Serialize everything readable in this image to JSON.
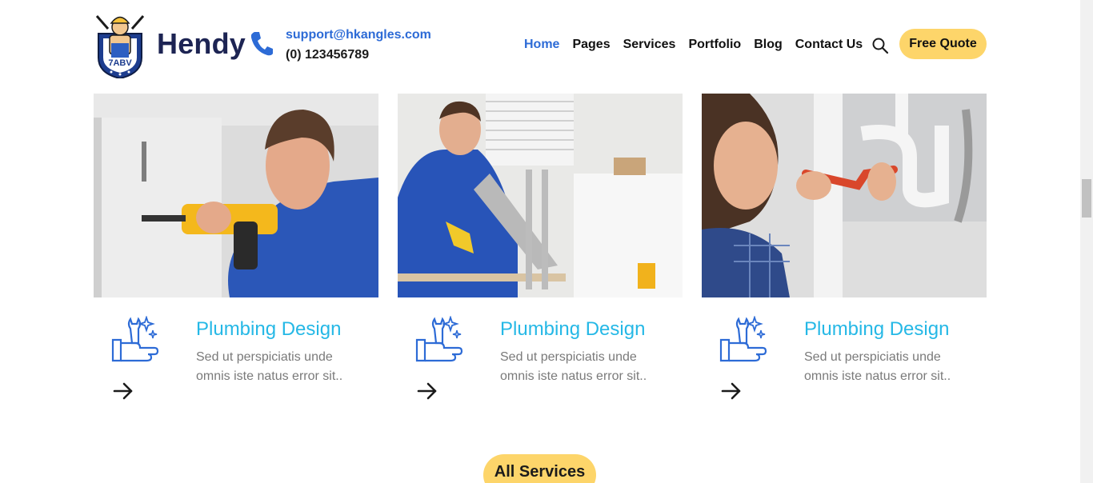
{
  "brand": {
    "name": "Hendy",
    "logo_icon": "plumber-mascot-logo"
  },
  "contact": {
    "email": "support@hkangles.com",
    "phone": "(0) 123456789",
    "icon": "phone-icon"
  },
  "nav": {
    "items": [
      {
        "label": "Home",
        "active": true
      },
      {
        "label": "Pages",
        "active": false
      },
      {
        "label": "Services",
        "active": false
      },
      {
        "label": "Portfolio",
        "active": false
      },
      {
        "label": "Blog",
        "active": false
      },
      {
        "label": "Contact Us",
        "active": false
      }
    ],
    "search_icon": "search-icon",
    "quote_label": "Free Quote"
  },
  "services": [
    {
      "title": "Plumbing Design",
      "desc": "Sed ut perspiciatis unde omnis iste natus error sit..",
      "icon": "wrench-hand-icon",
      "photo": "worker-drilling-cabinet"
    },
    {
      "title": "Plumbing Design",
      "desc": "Sed ut perspiciatis unde omnis iste natus error sit..",
      "icon": "wrench-hand-icon",
      "photo": "worker-sawing-ladder"
    },
    {
      "title": "Plumbing Design",
      "desc": "Sed ut perspiciatis unde omnis iste natus error sit..",
      "icon": "wrench-hand-icon",
      "photo": "worker-fixing-pipes"
    }
  ],
  "all_services_label": "All Services",
  "colors": {
    "accent_blue": "#2d6bd6",
    "title_cyan": "#25b8e6",
    "button_yellow": "#fdd56a",
    "brand_navy": "#1d2453"
  }
}
